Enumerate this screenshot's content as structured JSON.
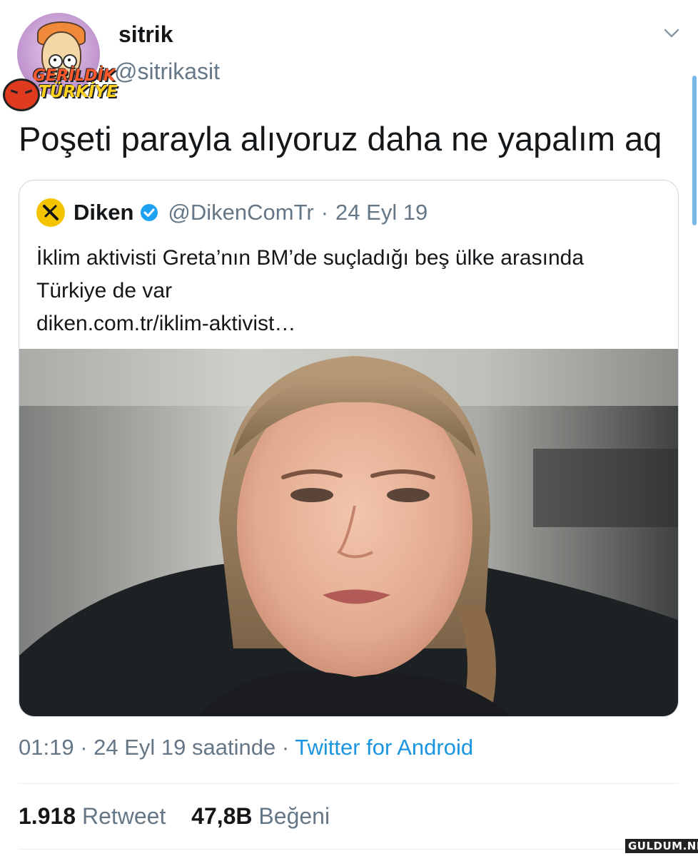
{
  "author": {
    "display_name": "sitrik",
    "handle": "@sitrikasit",
    "avatar_badge_line1": "GERİLDİK",
    "avatar_badge_line2": "TÜRKİYE"
  },
  "tweet": {
    "text": "Poşeti parayla alıyoruz daha ne yapalım aq"
  },
  "quoted_tweet": {
    "name": "Diken",
    "handle": "@DikenComTr",
    "separator": "·",
    "date": "24 Eyl 19",
    "text_line1": "İklim aktivisti Greta’nın BM’de suçladığı beş ülke arasında",
    "text_line2": "Türkiye de var",
    "link": "diken.com.tr/iklim-aktivist…",
    "verified": true
  },
  "meta": {
    "time": "01:19",
    "sep1": "·",
    "date_text": "24 Eyl 19 saatinde",
    "sep2": "·",
    "source": "Twitter for Android"
  },
  "stats": {
    "retweets_count": "1.918",
    "retweets_label": "Retweet",
    "likes_count": "47,8B",
    "likes_label": "Beğeni"
  },
  "icons": {
    "menu": "chevron-down-icon",
    "verified": "verified-badge-icon",
    "quoted_logo": "diken-logo-icon"
  },
  "colors": {
    "text_primary": "#14171a",
    "text_secondary": "#657786",
    "link": "#1b95e0",
    "verified": "#1da1f2",
    "border": "#ccd6dd"
  },
  "watermark": "GULDUM.NET"
}
